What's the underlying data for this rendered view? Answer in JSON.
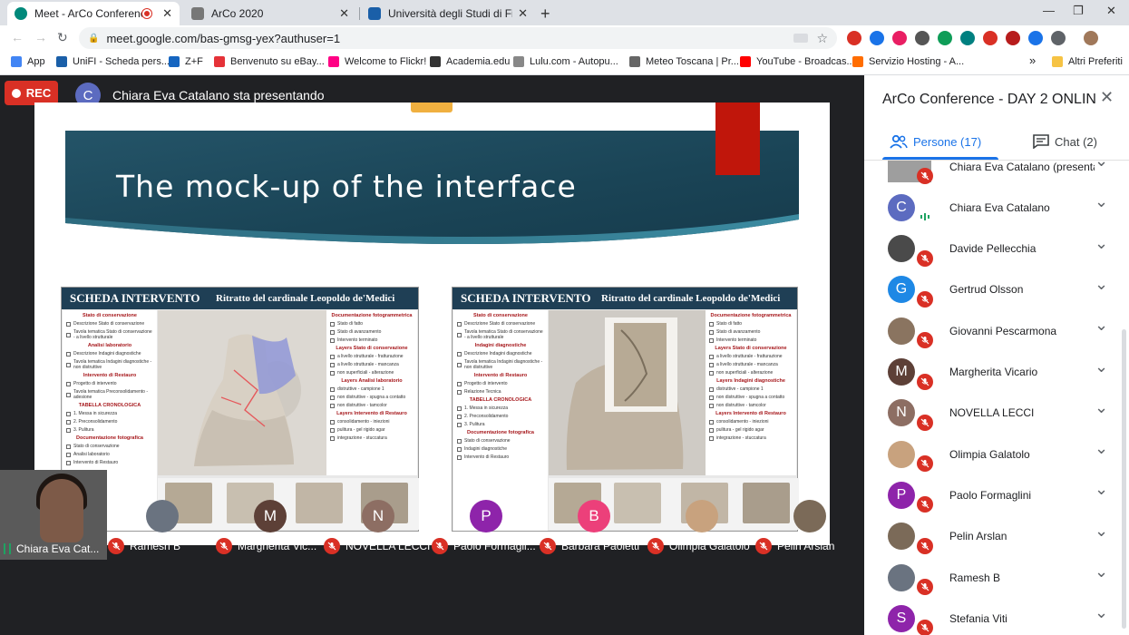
{
  "browser": {
    "tabs": [
      {
        "title": "Meet - ArCo Conference - DA",
        "active": true
      },
      {
        "title": "ArCo 2020",
        "active": false
      },
      {
        "title": "Università degli Studi di Firenze",
        "active": false
      }
    ],
    "url": "meet.google.com/bas-gmsg-yex?authuser=1",
    "extensions": [
      "#d93025",
      "#1a73e8",
      "#e91e63",
      "#555555",
      "#0f9d58",
      "#008080",
      "#d93025",
      "#b71c1c",
      "#1a73e8",
      "#5f6368"
    ],
    "bookmarks": [
      {
        "label": "App",
        "icon": "apps-grid-icon"
      },
      {
        "label": "UniFI - Scheda pers...",
        "icon": "unifi-icon"
      },
      {
        "label": "Z+F",
        "icon": "zf-icon"
      },
      {
        "label": "Benvenuto su eBay...",
        "icon": "ebay-icon"
      },
      {
        "label": "Welcome to Flickr!",
        "icon": "flickr-icon"
      },
      {
        "label": "Academia.edu",
        "icon": "academia-icon"
      },
      {
        "label": "Lulu.com - Autopu...",
        "icon": "lulu-icon"
      },
      {
        "label": "Meteo Toscana | Pr...",
        "icon": "meteo-icon"
      },
      {
        "label": "YouTube - Broadcas...",
        "icon": "youtube-icon"
      },
      {
        "label": "Servizio Hosting - A...",
        "icon": "hosting-icon"
      }
    ],
    "more_bookmarks": "»",
    "other_bookmarks": "Altri Preferiti"
  },
  "meet": {
    "rec_label": "REC",
    "presenter_initial": "C",
    "presenter_text": "Chiara Eva Catalano sta presentando",
    "slide": {
      "title": "The mock-up of the interface",
      "mockups": [
        {
          "header": "SCHEDA INTERVENTO",
          "subtitle": "Ritratto del cardinale Leopoldo de'Medici",
          "left_sections": [
            {
              "title": "Stato di conservazione",
              "items": [
                "Descrizione Stato di conservazione",
                "Tavola tematica Stato di conservazione - a livello strutturale"
              ]
            },
            {
              "title": "Analisi laboratorio",
              "items": [
                "Descrizione Indagini diagnostiche",
                "Tavola tematica Indagini diagnostiche - non distruttive"
              ]
            },
            {
              "title": "Intervento di Restauro",
              "items": [
                "Progetto di intervento",
                "Tavola tematica Preconsolidamento - adesione"
              ]
            },
            {
              "title": "TABELLA CRONOLOGICA",
              "items": [
                "1. Messa in sicurezza",
                "2. Preconsolidamento",
                "3. Pulitura"
              ]
            },
            {
              "title": "Documentazione fotografica",
              "items": [
                "Stato di conservazione",
                "Analisi laboratorio",
                "Intervento di Restauro"
              ]
            }
          ],
          "right_sections": [
            {
              "title": "Documentazione fotogrammetrica",
              "items": [
                "Stato di fatto",
                "Stato di avanzamento",
                "Intervento terminato"
              ]
            },
            {
              "title": "Layers Stato di conservazione",
              "items": [
                "a livello strutturale - fratturazione",
                "a livello strutturale - mancanza",
                "non superficiali - alterazione"
              ]
            },
            {
              "title": "Layers Analisi laboratorio",
              "items": [
                "distruttive - campione 1",
                "non distruttive - spugna a contatto",
                "non distruttive - tamcolor"
              ]
            },
            {
              "title": "Layers Intervento di Restauro",
              "items": [
                "consolidamento - iniezioni",
                "pulitura - gel rigido agar",
                "integrazione - stuccatura"
              ]
            }
          ],
          "view": "statue-3d"
        },
        {
          "header": "SCHEDA INTERVENTO",
          "subtitle": "Ritratto del cardinale Leopoldo de'Medici",
          "left_sections": [
            {
              "title": "Stato di conservazione",
              "items": [
                "Descrizione Stato di conservazione",
                "Tavola tematica Stato di conservazione - a livello strutturale"
              ]
            },
            {
              "title": "Indagini diagnostiche",
              "items": [
                "Descrizione Indagini diagnostiche",
                "Tavola tematica Indagini diagnostiche - non distruttive"
              ]
            },
            {
              "title": "Intervento di Restauro",
              "items": [
                "Progetto di intervento",
                "Relazione Tecnica"
              ]
            },
            {
              "title": "TABELLA CRONOLOGICA",
              "items": [
                "1. Messa in sicurezza",
                "2. Preconsolidamento",
                "3. Pulitura"
              ]
            },
            {
              "title": "Documentazione fotografica",
              "items": [
                "Stato di conservazione",
                "Indagini diagnostiche",
                "Intervento di Restauro"
              ]
            }
          ],
          "right_sections": [
            {
              "title": "Documentazione fotogrammetrica",
              "items": [
                "Stato di fatto",
                "Stato di avanzamento",
                "Intervento terminato"
              ]
            },
            {
              "title": "Layers Stato di conservazione",
              "items": [
                "a livello strutturale - fratturazione",
                "a livello strutturale - mancanza",
                "non superficiali - alterazione"
              ]
            },
            {
              "title": "Layers Indagini diagnostiche",
              "items": [
                "distruttive - campione 1",
                "non distruttive - spugna a contatto",
                "non distruttive - tamcolor"
              ]
            },
            {
              "title": "Layers Intervento di Restauro",
              "items": [
                "consolidamento - iniezioni",
                "pulitura - gel rigido agar",
                "integrazione - stuccatura"
              ]
            }
          ],
          "view": "statue-with-photo"
        }
      ]
    },
    "self_name": "Chiara Eva Cat...",
    "tiles": [
      {
        "name": "Ramesh B",
        "initial": "",
        "color": "#6a7380",
        "photo": true
      },
      {
        "name": "Margherita Vic...",
        "initial": "M",
        "color": "#5d4037",
        "photo": false
      },
      {
        "name": "NOVELLA LECCI",
        "initial": "N",
        "color": "#8d6e63",
        "photo": false
      },
      {
        "name": "Paolo Formagli...",
        "initial": "P",
        "color": "#8e24aa",
        "photo": false
      },
      {
        "name": "Barbara Paoletti",
        "initial": "B",
        "color": "#ec407a",
        "photo": false
      },
      {
        "name": "Olimpia Galatolo",
        "initial": "",
        "color": "#c8a27e",
        "photo": true
      },
      {
        "name": "Pelin Arslan",
        "initial": "",
        "color": "#7b6a58",
        "photo": true
      }
    ]
  },
  "sidebar": {
    "title": "ArCo Conference - DAY 2 ONLIN...",
    "tab_people": "Persone (17)",
    "tab_chat": "Chat (2)",
    "people": [
      {
        "name": "Chiara Eva Catalano (presenta...",
        "initial": "",
        "color": "#7b6a58",
        "photo": true,
        "mic": "off"
      },
      {
        "name": "Chiara Eva Catalano",
        "initial": "C",
        "color": "#5c6bc0",
        "photo": false,
        "mic": "speaking"
      },
      {
        "name": "Davide Pellecchia",
        "initial": "",
        "color": "#4a4a4a",
        "photo": true,
        "mic": "off"
      },
      {
        "name": "Gertrud Olsson",
        "initial": "G",
        "color": "#1e88e5",
        "photo": false,
        "mic": "off"
      },
      {
        "name": "Giovanni Pescarmona",
        "initial": "",
        "color": "#8a7460",
        "photo": true,
        "mic": "off"
      },
      {
        "name": "Margherita Vicario",
        "initial": "M",
        "color": "#5d4037",
        "photo": false,
        "mic": "off"
      },
      {
        "name": "NOVELLA LECCI",
        "initial": "N",
        "color": "#8d6e63",
        "photo": false,
        "mic": "off"
      },
      {
        "name": "Olimpia Galatolo",
        "initial": "",
        "color": "#c8a27e",
        "photo": true,
        "mic": "off"
      },
      {
        "name": "Paolo Formaglini",
        "initial": "P",
        "color": "#8e24aa",
        "photo": false,
        "mic": "off"
      },
      {
        "name": "Pelin Arslan",
        "initial": "",
        "color": "#7b6a58",
        "photo": true,
        "mic": "off"
      },
      {
        "name": "Ramesh B",
        "initial": "",
        "color": "#6a7380",
        "photo": true,
        "mic": "off"
      },
      {
        "name": "Stefania Viti",
        "initial": "S",
        "color": "#8e24aa",
        "photo": false,
        "mic": "off"
      }
    ]
  }
}
